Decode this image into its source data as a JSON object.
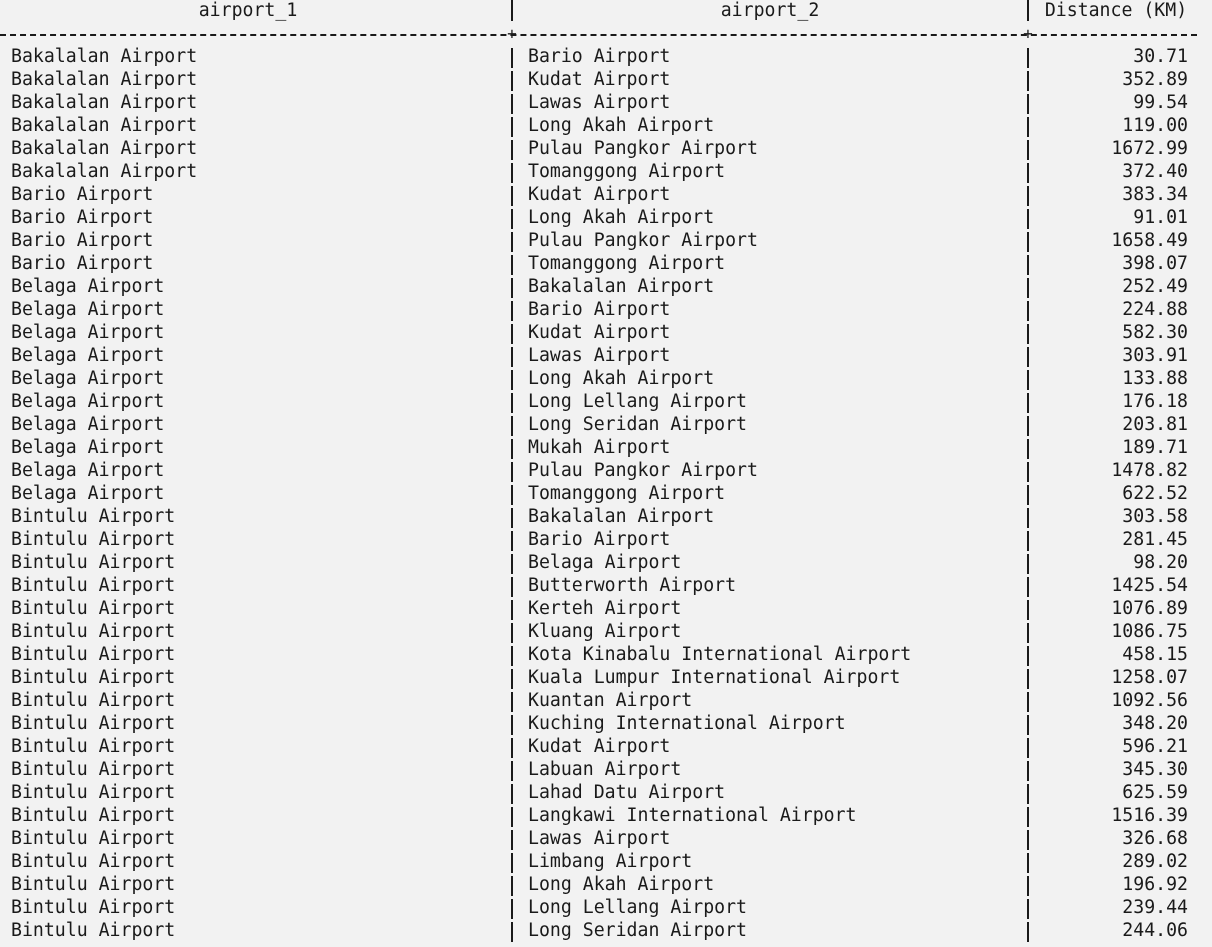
{
  "columns": [
    "airport_1",
    "airport_2",
    "Distance (KM)"
  ],
  "separator": {
    "plus": "+"
  },
  "rows": [
    [
      "Bakalalan Airport",
      "Bario Airport",
      "30.71"
    ],
    [
      "Bakalalan Airport",
      "Kudat Airport",
      "352.89"
    ],
    [
      "Bakalalan Airport",
      "Lawas Airport",
      "99.54"
    ],
    [
      "Bakalalan Airport",
      "Long Akah Airport",
      "119.00"
    ],
    [
      "Bakalalan Airport",
      "Pulau Pangkor Airport",
      "1672.99"
    ],
    [
      "Bakalalan Airport",
      "Tomanggong Airport",
      "372.40"
    ],
    [
      "Bario Airport",
      "Kudat Airport",
      "383.34"
    ],
    [
      "Bario Airport",
      "Long Akah Airport",
      "91.01"
    ],
    [
      "Bario Airport",
      "Pulau Pangkor Airport",
      "1658.49"
    ],
    [
      "Bario Airport",
      "Tomanggong Airport",
      "398.07"
    ],
    [
      "Belaga Airport",
      "Bakalalan Airport",
      "252.49"
    ],
    [
      "Belaga Airport",
      "Bario Airport",
      "224.88"
    ],
    [
      "Belaga Airport",
      "Kudat Airport",
      "582.30"
    ],
    [
      "Belaga Airport",
      "Lawas Airport",
      "303.91"
    ],
    [
      "Belaga Airport",
      "Long Akah Airport",
      "133.88"
    ],
    [
      "Belaga Airport",
      "Long Lellang Airport",
      "176.18"
    ],
    [
      "Belaga Airport",
      "Long Seridan Airport",
      "203.81"
    ],
    [
      "Belaga Airport",
      "Mukah Airport",
      "189.71"
    ],
    [
      "Belaga Airport",
      "Pulau Pangkor Airport",
      "1478.82"
    ],
    [
      "Belaga Airport",
      "Tomanggong Airport",
      "622.52"
    ],
    [
      "Bintulu Airport",
      "Bakalalan Airport",
      "303.58"
    ],
    [
      "Bintulu Airport",
      "Bario Airport",
      "281.45"
    ],
    [
      "Bintulu Airport",
      "Belaga Airport",
      "98.20"
    ],
    [
      "Bintulu Airport",
      "Butterworth Airport",
      "1425.54"
    ],
    [
      "Bintulu Airport",
      "Kerteh Airport",
      "1076.89"
    ],
    [
      "Bintulu Airport",
      "Kluang Airport",
      "1086.75"
    ],
    [
      "Bintulu Airport",
      "Kota Kinabalu International Airport",
      "458.15"
    ],
    [
      "Bintulu Airport",
      "Kuala Lumpur International Airport",
      "1258.07"
    ],
    [
      "Bintulu Airport",
      "Kuantan Airport",
      "1092.56"
    ],
    [
      "Bintulu Airport",
      "Kuching International Airport",
      "348.20"
    ],
    [
      "Bintulu Airport",
      "Kudat Airport",
      "596.21"
    ],
    [
      "Bintulu Airport",
      "Labuan Airport",
      "345.30"
    ],
    [
      "Bintulu Airport",
      "Lahad Datu Airport",
      "625.59"
    ],
    [
      "Bintulu Airport",
      "Langkawi International Airport",
      "1516.39"
    ],
    [
      "Bintulu Airport",
      "Lawas Airport",
      "326.68"
    ],
    [
      "Bintulu Airport",
      "Limbang Airport",
      "289.02"
    ],
    [
      "Bintulu Airport",
      "Long Akah Airport",
      "196.92"
    ],
    [
      "Bintulu Airport",
      "Long Lellang Airport",
      "239.44"
    ],
    [
      "Bintulu Airport",
      "Long Seridan Airport",
      "244.06"
    ]
  ]
}
